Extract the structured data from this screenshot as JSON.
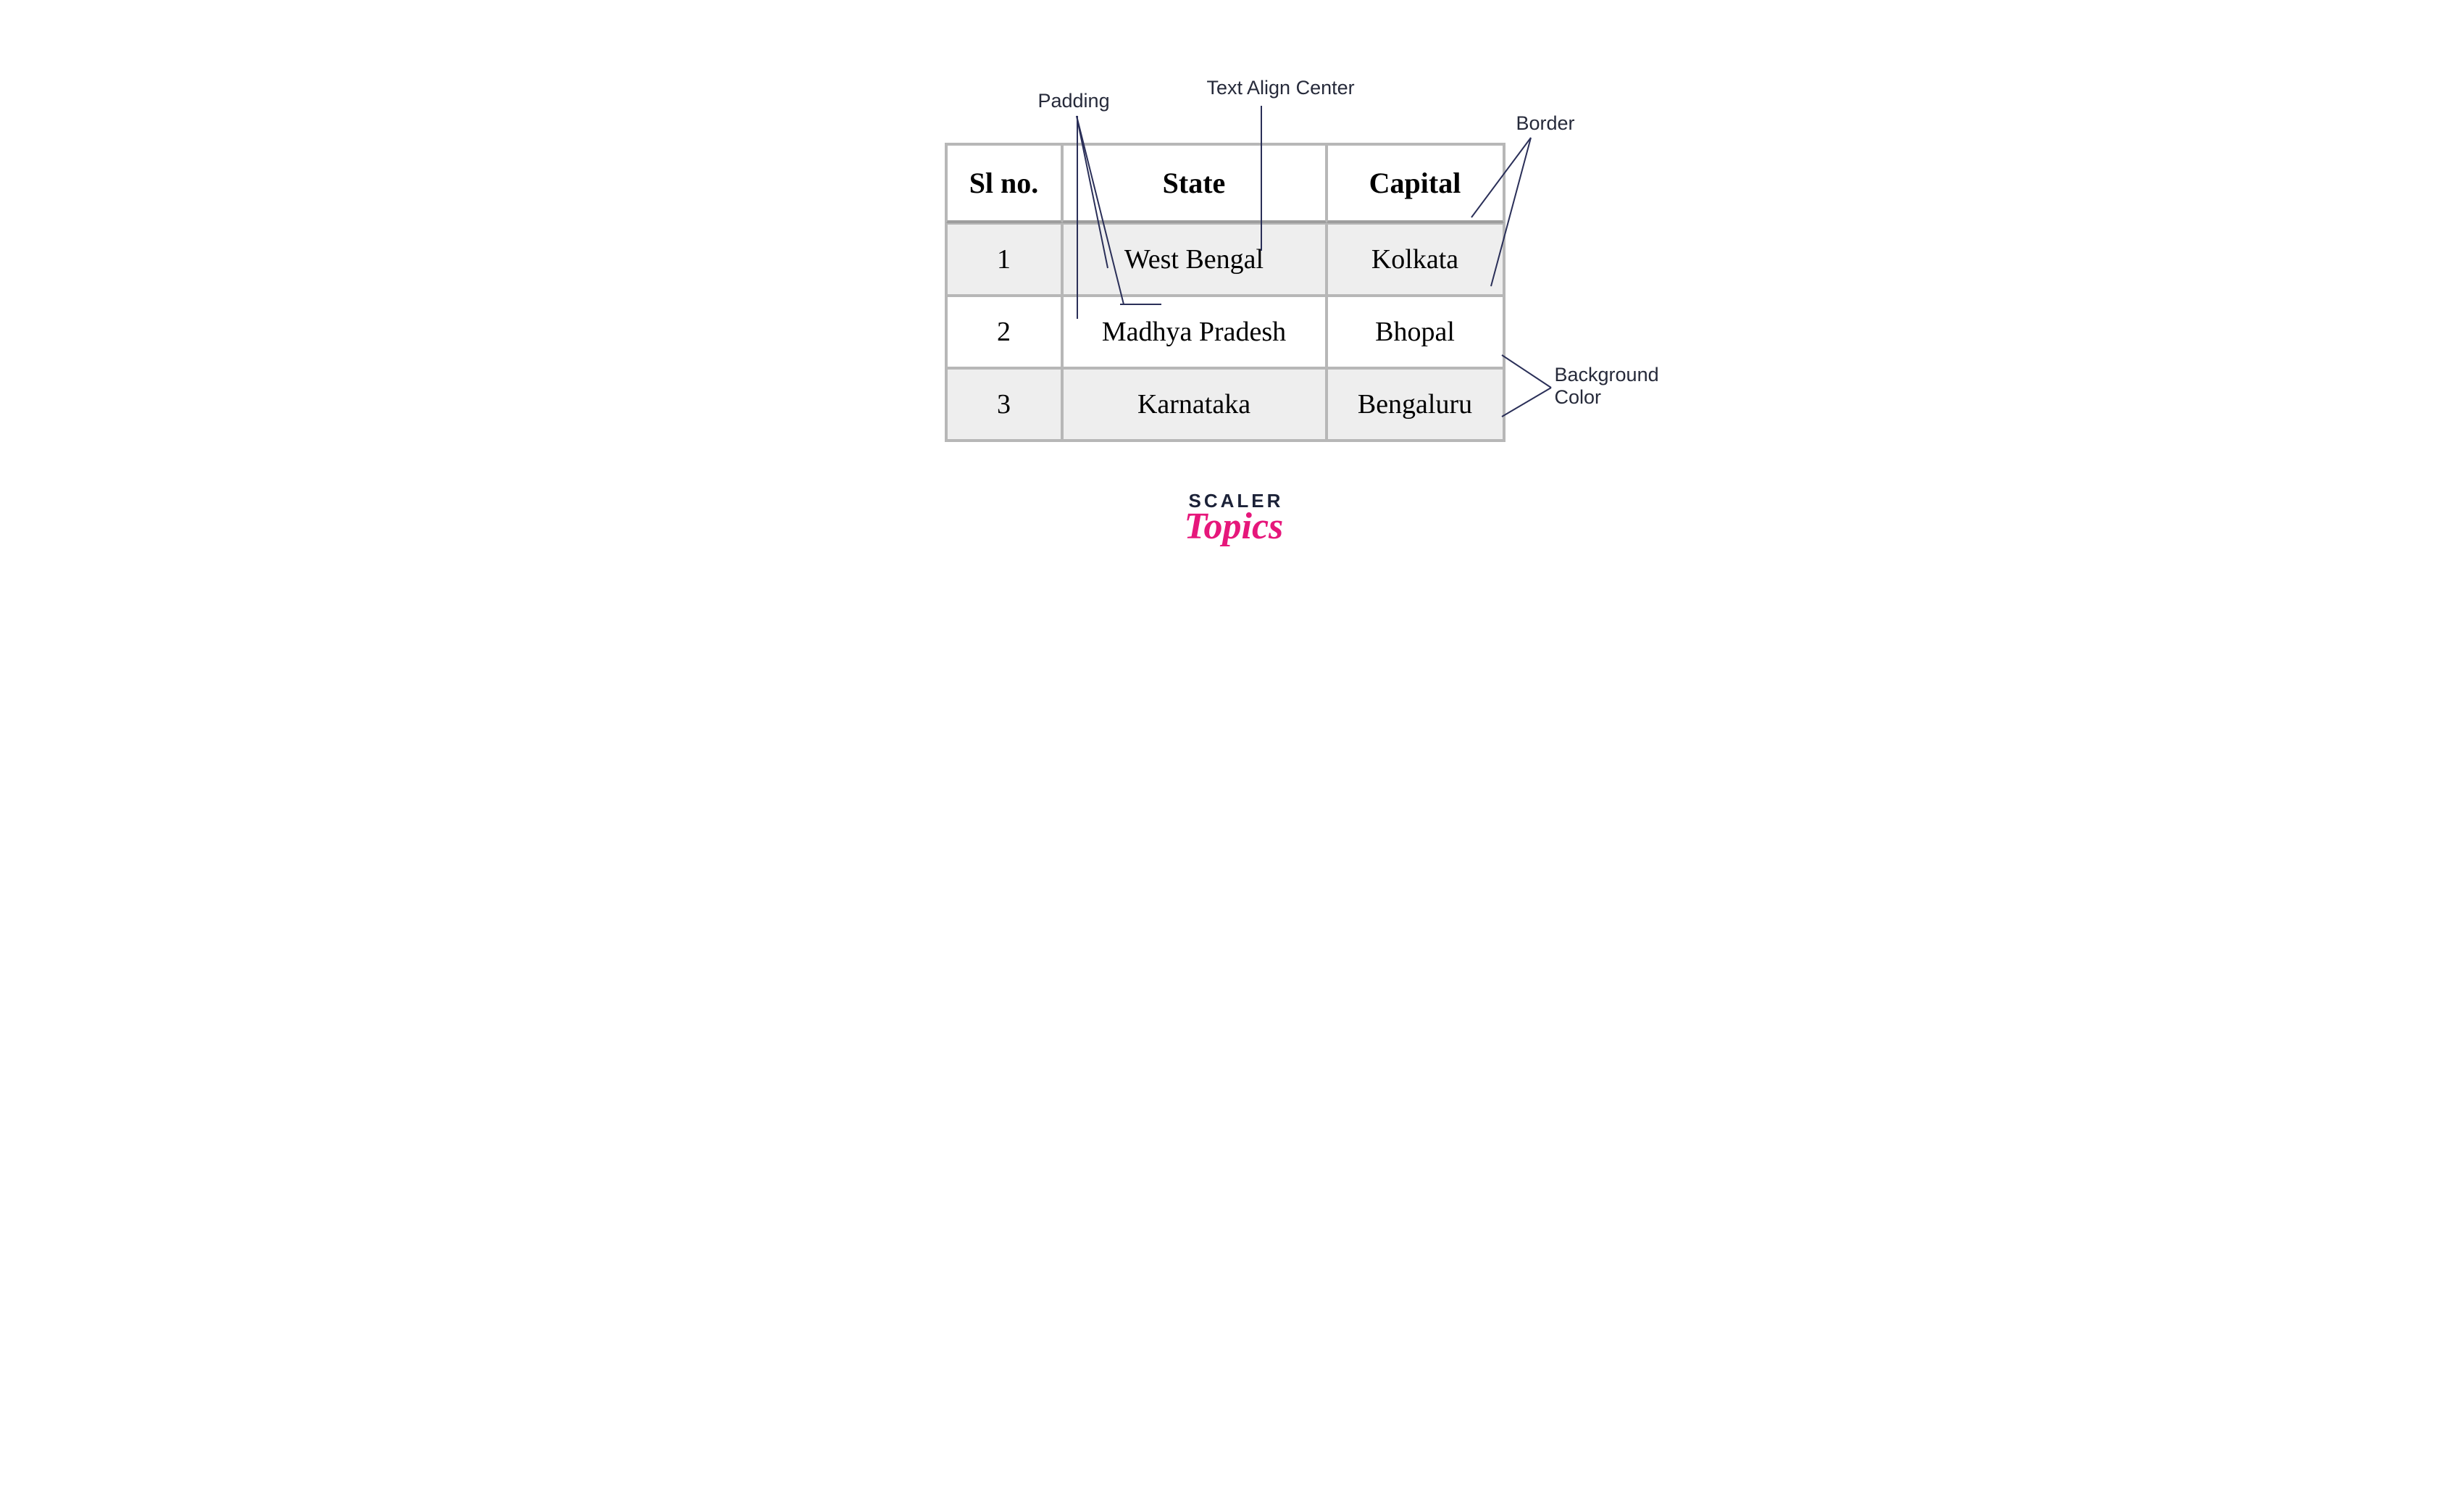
{
  "annotations": {
    "padding": "Padding",
    "text_align_center": "Text Align Center",
    "border": "Border",
    "background_color_line1": "Background",
    "background_color_line2": "Color"
  },
  "table": {
    "headers": {
      "sl_no": "Sl no.",
      "state": "State",
      "capital": "Capital"
    },
    "rows": [
      {
        "sl": "1",
        "state": "West Bengal",
        "capital": "Kolkata"
      },
      {
        "sl": "2",
        "state": "Madhya Pradesh",
        "capital": "Bhopal"
      },
      {
        "sl": "3",
        "state": "Karnataka",
        "capital": "Bengaluru"
      }
    ]
  },
  "logo": {
    "line1": "SCALER",
    "line2": "Topics"
  }
}
